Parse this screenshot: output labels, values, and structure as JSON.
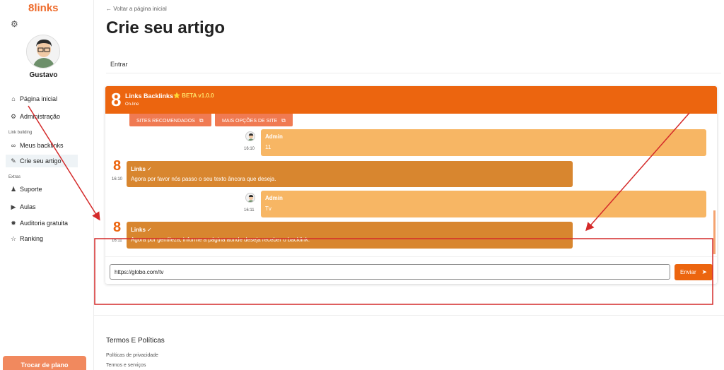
{
  "sidebar": {
    "brand": "8links",
    "username": "Gustavo",
    "items": [
      {
        "label": "Página inicial",
        "icon": "home-icon",
        "glyph": "⌂"
      },
      {
        "label": "Administração",
        "icon": "cogs-icon",
        "glyph": "⚙"
      },
      {
        "label": "Meus backlinks",
        "icon": "link-icon",
        "glyph": "🔗"
      },
      {
        "label": "Crie seu artigo",
        "icon": "edit-icon",
        "glyph": "✎"
      },
      {
        "label": "Suporte",
        "icon": "user-support-icon",
        "glyph": "👥"
      },
      {
        "label": "Aulas",
        "icon": "play-circle-icon",
        "glyph": "▶"
      },
      {
        "label": "Auditoria gratuita",
        "icon": "badge-icon",
        "glyph": "✹"
      },
      {
        "label": "Ranking",
        "icon": "star-icon",
        "glyph": "☆"
      }
    ],
    "section_link_building": "Link building",
    "section_extras": "Extras",
    "switch_plan": "Trocar de plano"
  },
  "main": {
    "back_link": "← Voltar a página inicial",
    "title": "Crie seu artigo",
    "tab": "Entrar"
  },
  "chat": {
    "bot_logo": "8",
    "bot_name": "Links Backlinks",
    "beta": "⭐ BETA v1.0.0",
    "status": "On-line",
    "buttons": [
      "SITES RECOMENDADOS",
      "MAIS OPÇÕES DE SITE"
    ],
    "messages": [
      {
        "author": "Admin",
        "text": "11",
        "time": "16:10"
      },
      {
        "author": "Links ✓",
        "text": "Agora por favor nós passo o seu texto âncora que deseja.",
        "time": "16:10"
      },
      {
        "author": "Admin",
        "text": "Tv",
        "time": "16:11"
      },
      {
        "author": "Links ✓",
        "text": "Agora por gentileza, informe a página aonde deseja receber o backlink.",
        "time": "16:11"
      }
    ],
    "input_value": "https://globo.com/tv",
    "send_label": "Enviar"
  },
  "footer": {
    "title": "Termos E Políticas",
    "links": [
      "Políticas de privacidade",
      "Termos e serviços"
    ]
  },
  "colors": {
    "accent": "#ec650f",
    "admin_bubble": "#f7b664",
    "bot_bubble": "#d8862f",
    "annotation": "#d42a2a"
  }
}
